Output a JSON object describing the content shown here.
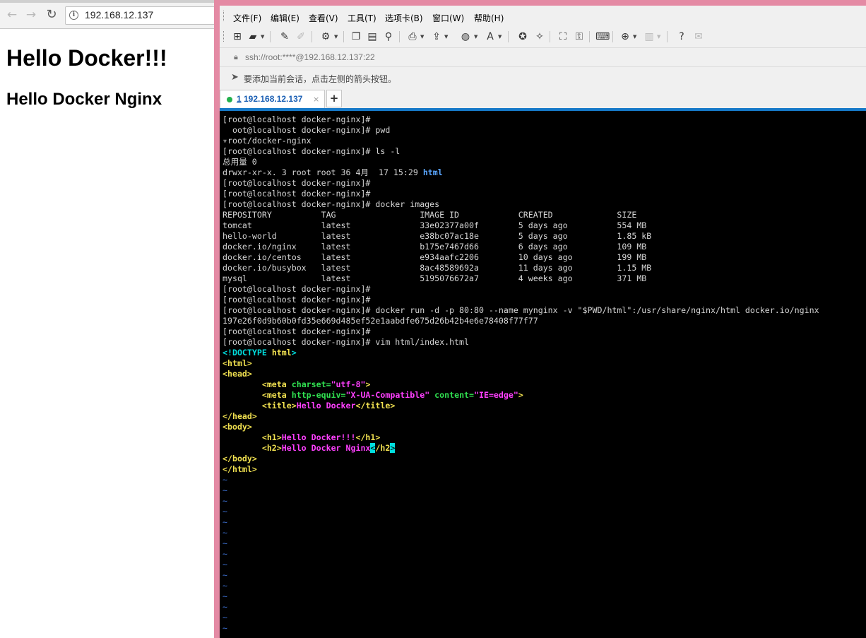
{
  "browser": {
    "url": "192.168.12.137",
    "heading1": "Hello Docker!!!",
    "heading2": "Hello Docker Nginx"
  },
  "xshell": {
    "menu": [
      "文件(F)",
      "编辑(E)",
      "查看(V)",
      "工具(T)",
      "选项卡(B)",
      "窗口(W)",
      "帮助(H)"
    ],
    "address": "ssh://root:****@192.168.12.137:22",
    "hint": "要添加当前会话，点击左侧的箭头按钮。",
    "tab": {
      "number": "1",
      "label": "192.168.12.137"
    },
    "colors": {
      "tab_accent": "#1679c8",
      "frame": "#e48aa4",
      "session_dot": "#22b14c"
    }
  },
  "terminal": {
    "prompt": "[root@localhost docker-nginx]#",
    "lines": {
      "l1": "[root@localhost docker-nginx]#",
      "l2": "  oot@localhost docker-nginx]# pwd",
      "l3": "▿root/docker-nginx",
      "l4": "[root@localhost docker-nginx]# ls -l",
      "l5": "总用量 0",
      "l6a": "drwxr-xr-x. 3 root root 36 4月  17 15:29 ",
      "l6b": "html",
      "l7": "[root@localhost docker-nginx]#",
      "l8": "[root@localhost docker-nginx]#",
      "l9": "[root@localhost docker-nginx]# docker images",
      "l10": "[root@localhost docker-nginx]#",
      "l11": "[root@localhost docker-nginx]#",
      "l12": "[root@localhost docker-nginx]# docker run -d -p 80:80 --name mynginx -v \"$PWD/html\":/usr/share/nginx/html docker.io/nginx",
      "l13": "197e26f0d9b60b0fd35e669d485ef52e1aabdfe675d26b42b4e6e78408f77f77",
      "l14": "[root@localhost docker-nginx]#",
      "l15": "[root@localhost docker-nginx]# vim html/index.html"
    },
    "images": {
      "header": "REPOSITORY          TAG                 IMAGE ID            CREATED             SIZE",
      "rows": [
        "tomcat              latest              33e02377a00f        5 days ago          554 MB",
        "hello-world         latest              e38bc07ac18e        5 days ago          1.85 kB",
        "docker.io/nginx     latest              b175e7467d66        6 days ago          109 MB",
        "docker.io/centos    latest              e934aafc2206        10 days ago         199 MB",
        "docker.io/busybox   latest              8ac48589692a        11 days ago         1.15 MB",
        "mysql               latest              5195076672a7        4 weeks ago         371 MB"
      ]
    },
    "vim": {
      "doctype_open": "<!DOCTYPE ",
      "doctype_name": "html",
      "doctype_close": ">",
      "html_open": "<html>",
      "head_open": "<head>",
      "meta_tag": "<meta ",
      "charset_attr": "charset=",
      "charset_val": "\"utf-8\"",
      "http_equiv_attr": "http-equiv=",
      "http_equiv_val": "\"X-UA-Compatible\"",
      "content_attr": " content=",
      "content_val": "\"IE=edge\"",
      "tag_close": ">",
      "title_open": "<title>",
      "title_text": "Hello Docker",
      "title_close": "</title>",
      "head_close": "</head>",
      "body_open": "<body>",
      "h1_open": "<h1>",
      "h1_text": "Hello Docker!!!",
      "h1_close": "</h1>",
      "h2_open": "<h2>",
      "h2_text": "Hello Docker Nginx",
      "h2_close_a": "<",
      "h2_close_b": "/h2",
      "h2_close_c": ">",
      "body_close": "</body>",
      "html_close": "</html>",
      "tilde": "~"
    }
  }
}
